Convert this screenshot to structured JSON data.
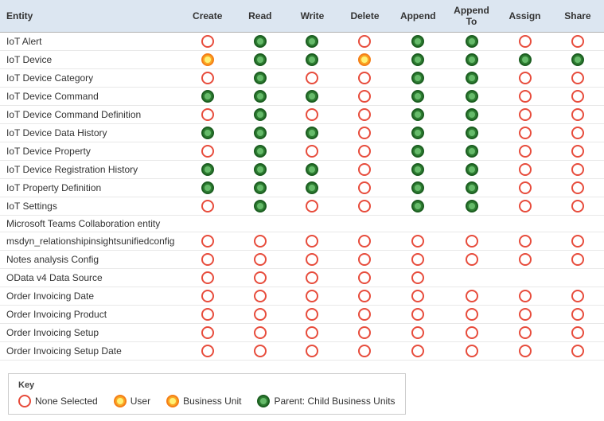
{
  "table": {
    "headers": [
      "Entity",
      "Create",
      "Read",
      "Write",
      "Delete",
      "Append",
      "Append To",
      "Assign",
      "Share"
    ],
    "rows": [
      {
        "entity": "IoT Alert",
        "create": "empty",
        "read": "green",
        "write": "green",
        "delete": "empty",
        "append": "green",
        "appendTo": "green",
        "assign": "empty",
        "share": "empty"
      },
      {
        "entity": "IoT Device",
        "create": "yellow",
        "read": "green",
        "write": "green",
        "delete": "yellow",
        "append": "green",
        "appendTo": "green",
        "assign": "green",
        "share": "green"
      },
      {
        "entity": "IoT Device Category",
        "create": "empty",
        "read": "green",
        "write": "empty",
        "delete": "empty",
        "append": "green",
        "appendTo": "green",
        "assign": "empty",
        "share": "empty"
      },
      {
        "entity": "IoT Device Command",
        "create": "green",
        "read": "green",
        "write": "green",
        "delete": "empty",
        "append": "green",
        "appendTo": "green",
        "assign": "empty",
        "share": "empty"
      },
      {
        "entity": "IoT Device Command Definition",
        "create": "empty",
        "read": "green",
        "write": "empty",
        "delete": "empty",
        "append": "green",
        "appendTo": "green",
        "assign": "empty",
        "share": "empty"
      },
      {
        "entity": "IoT Device Data History",
        "create": "green",
        "read": "green",
        "write": "green",
        "delete": "empty",
        "append": "green",
        "appendTo": "green",
        "assign": "empty",
        "share": "empty"
      },
      {
        "entity": "IoT Device Property",
        "create": "empty",
        "read": "green",
        "write": "empty",
        "delete": "empty",
        "append": "green",
        "appendTo": "green",
        "assign": "empty",
        "share": "empty"
      },
      {
        "entity": "IoT Device Registration History",
        "create": "green",
        "read": "green",
        "write": "green",
        "delete": "empty",
        "append": "green",
        "appendTo": "green",
        "assign": "empty",
        "share": "empty"
      },
      {
        "entity": "IoT Property Definition",
        "create": "green",
        "read": "green",
        "write": "green",
        "delete": "empty",
        "append": "green",
        "appendTo": "green",
        "assign": "empty",
        "share": "empty"
      },
      {
        "entity": "IoT Settings",
        "create": "empty",
        "read": "green",
        "write": "empty",
        "delete": "empty",
        "append": "green",
        "appendTo": "green",
        "assign": "empty",
        "share": "empty"
      },
      {
        "entity": "Microsoft Teams Collaboration entity",
        "create": "none",
        "read": "none",
        "write": "none",
        "delete": "none",
        "append": "none",
        "appendTo": "none",
        "assign": "none",
        "share": "none"
      },
      {
        "entity": "msdyn_relationshipinsightsunifiedconfig",
        "create": "empty",
        "read": "empty",
        "write": "empty",
        "delete": "empty",
        "append": "empty",
        "appendTo": "empty",
        "assign": "empty",
        "share": "empty"
      },
      {
        "entity": "Notes analysis Config",
        "create": "empty",
        "read": "empty",
        "write": "empty",
        "delete": "empty",
        "append": "empty",
        "appendTo": "empty",
        "assign": "empty",
        "share": "empty"
      },
      {
        "entity": "OData v4 Data Source",
        "create": "empty",
        "read": "empty",
        "write": "empty",
        "delete": "empty",
        "append": "empty",
        "appendTo": "none",
        "assign": "none",
        "share": "none"
      },
      {
        "entity": "Order Invoicing Date",
        "create": "empty",
        "read": "empty",
        "write": "empty",
        "delete": "empty",
        "append": "empty",
        "appendTo": "empty",
        "assign": "empty",
        "share": "empty"
      },
      {
        "entity": "Order Invoicing Product",
        "create": "empty",
        "read": "empty",
        "write": "empty",
        "delete": "empty",
        "append": "empty",
        "appendTo": "empty",
        "assign": "empty",
        "share": "empty"
      },
      {
        "entity": "Order Invoicing Setup",
        "create": "empty",
        "read": "empty",
        "write": "empty",
        "delete": "empty",
        "append": "empty",
        "appendTo": "empty",
        "assign": "empty",
        "share": "empty"
      },
      {
        "entity": "Order Invoicing Setup Date",
        "create": "empty",
        "read": "empty",
        "write": "empty",
        "delete": "empty",
        "append": "empty",
        "appendTo": "empty",
        "assign": "empty",
        "share": "empty"
      }
    ]
  },
  "key": {
    "title": "Key",
    "items": [
      {
        "type": "empty",
        "label": "None Selected"
      },
      {
        "type": "user",
        "label": "User"
      },
      {
        "type": "yellow",
        "label": "Business Unit"
      },
      {
        "type": "green",
        "label": "Parent: Child Business Units"
      }
    ]
  }
}
